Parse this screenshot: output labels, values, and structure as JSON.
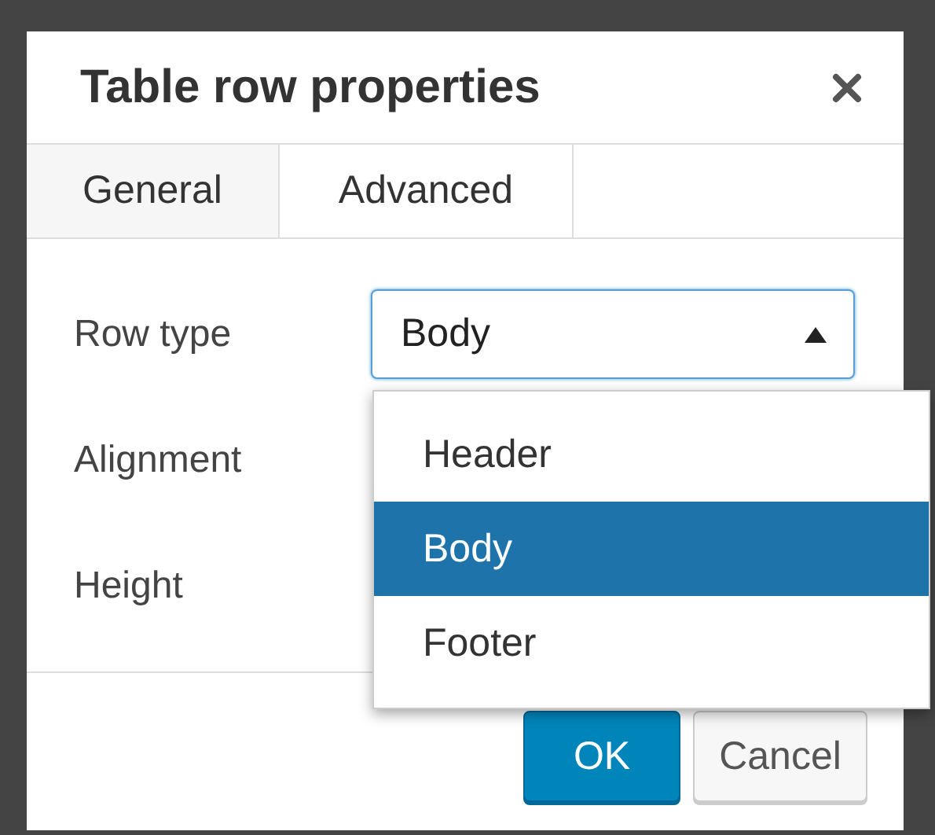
{
  "dialog": {
    "title": "Table row properties"
  },
  "tabs": [
    {
      "label": "General",
      "selected": true
    },
    {
      "label": "Advanced",
      "selected": false
    }
  ],
  "fields": [
    {
      "kind": "select",
      "label": "Row type",
      "value": "Body",
      "expanded": true,
      "options": [
        {
          "label": "Header",
          "selected": false
        },
        {
          "label": "Body",
          "selected": true
        },
        {
          "label": "Footer",
          "selected": false
        }
      ]
    },
    {
      "kind": "covered",
      "label": "Alignment"
    },
    {
      "kind": "covered",
      "label": "Height"
    }
  ],
  "buttons": [
    {
      "label": "OK",
      "primary": true
    },
    {
      "label": "Cancel",
      "primary": false
    }
  ]
}
